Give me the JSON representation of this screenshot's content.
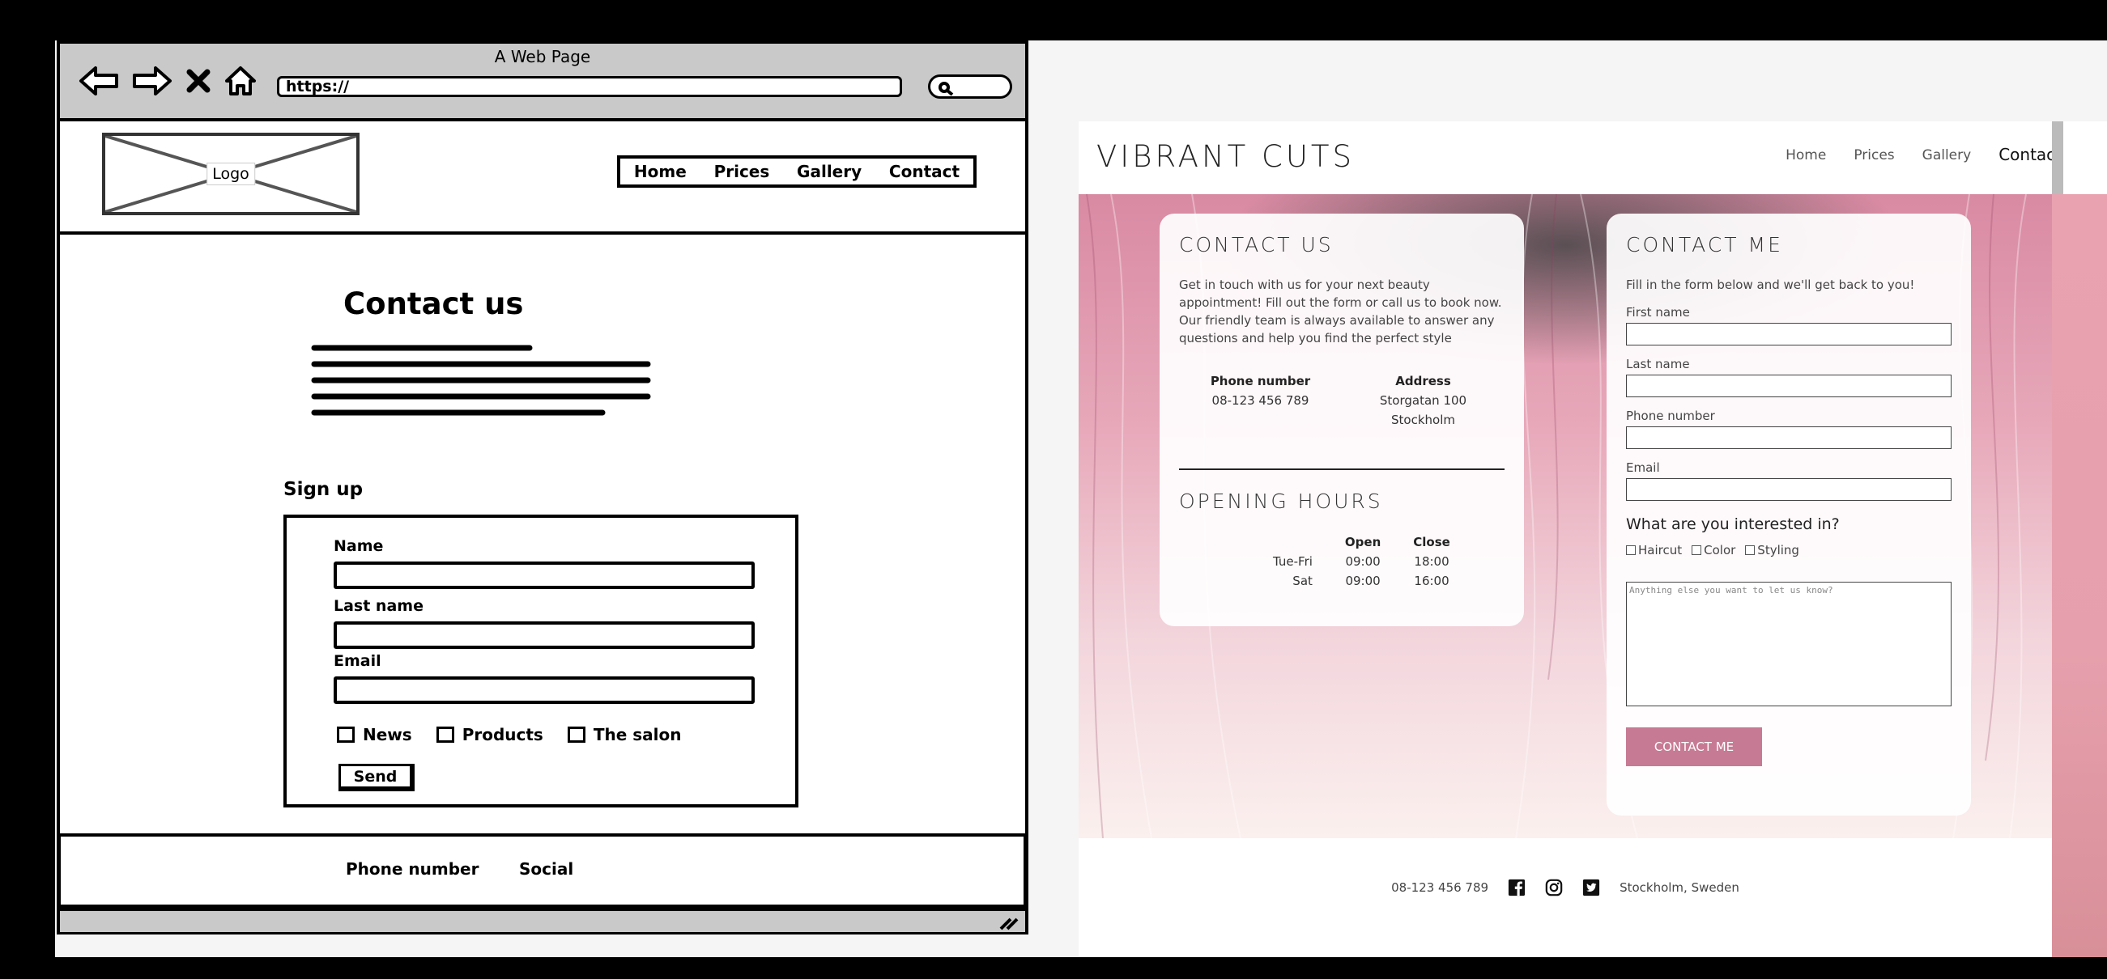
{
  "wireframe": {
    "window_title": "A Web Page",
    "url": "https://",
    "logo_label": "Logo",
    "menu": [
      "Home",
      "Prices",
      "Gallery",
      "Contact"
    ],
    "heading": "Contact us",
    "signup_heading": "Sign up",
    "form": {
      "name_label": "Name",
      "lastname_label": "Last name",
      "email_label": "Email",
      "checkboxes": [
        "News",
        "Products",
        "The salon"
      ],
      "send_label": "Send"
    },
    "footer": [
      "Phone number",
      "Social"
    ]
  },
  "site": {
    "brand": "VIBRANT CUTS",
    "nav": [
      "Home",
      "Prices",
      "Gallery",
      "Contact"
    ],
    "contact_us": {
      "title": "CONTACT US",
      "intro": "Get in touch with us for your next beauty appointment! Fill out the form or call us to book now. Our friendly team is always available to answer any questions and help you find the perfect style",
      "phone_heading": "Phone number",
      "phone": "08-123 456 789",
      "address_heading": "Address",
      "address_line1": "Storgatan 100",
      "address_line2": "Stockholm"
    },
    "opening_hours": {
      "title": "OPENING HOURS",
      "col_open": "Open",
      "col_close": "Close",
      "rows": [
        {
          "day": "Tue-Fri",
          "open": "09:00",
          "close": "18:00"
        },
        {
          "day": "Sat",
          "open": "09:00",
          "close": "16:00"
        }
      ]
    },
    "contact_me": {
      "title": "CONTACT ME",
      "intro": "Fill in the form below and we'll get back to you!",
      "first_name": "First name",
      "last_name": "Last name",
      "phone": "Phone number",
      "email": "Email",
      "question": "What are you interested in?",
      "options": [
        "Haircut",
        "Color",
        "Styling"
      ],
      "textarea_placeholder": "Anything else you want to let us know?",
      "submit": "CONTACT ME"
    },
    "footer": {
      "phone": "08-123 456 789",
      "location": "Stockholm, Sweden",
      "social_icons": [
        "facebook-icon",
        "instagram-icon",
        "twitter-icon"
      ]
    },
    "accent_color": "#c77a94"
  }
}
